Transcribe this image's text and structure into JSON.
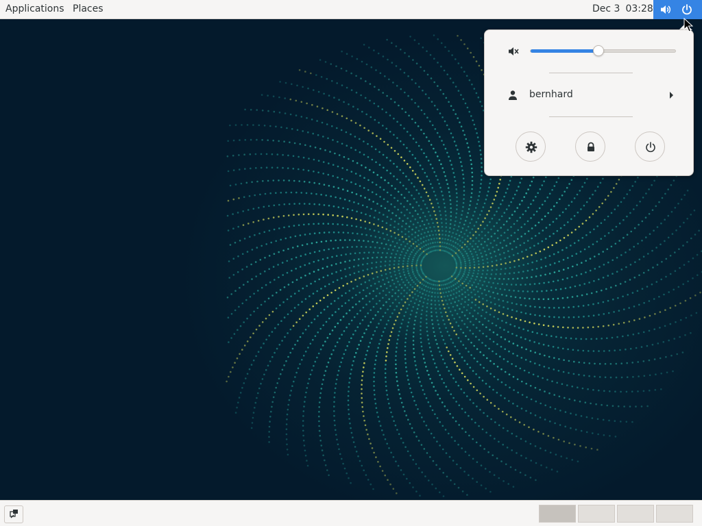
{
  "topbar": {
    "applications_label": "Applications",
    "places_label": "Places",
    "date": "Dec 3",
    "time": "03:28"
  },
  "popup": {
    "volume": {
      "level_fraction": 0.47,
      "icon": "audio-volume-muted-icon"
    },
    "user": {
      "name": "bernhard"
    },
    "buttons": [
      "settings",
      "lock",
      "power-off"
    ]
  },
  "colors": {
    "accent": "#3584e4",
    "panel": "#f6f5f4",
    "desktop": "#041a2c"
  },
  "workspaces": {
    "count": 4,
    "active": 0
  }
}
